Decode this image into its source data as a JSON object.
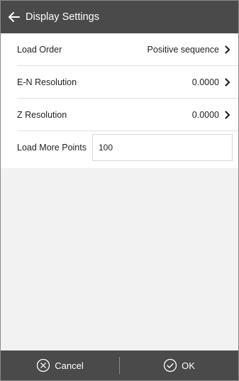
{
  "header": {
    "title": "Display Settings",
    "back_icon": "arrow-left-icon"
  },
  "rows": [
    {
      "label": "Load Order",
      "value": "Positive sequence",
      "icon": "chevron-right-icon"
    },
    {
      "label": "E-N Resolution",
      "value": "0.0000",
      "icon": "chevron-right-icon"
    },
    {
      "label": "Z Resolution",
      "value": "0.0000",
      "icon": "chevron-right-icon"
    }
  ],
  "load_more": {
    "label": "Load More Points",
    "value": "100"
  },
  "footer": {
    "cancel_label": "Cancel",
    "cancel_icon": "cancel-circle-icon",
    "ok_label": "OK",
    "ok_icon": "check-circle-icon"
  },
  "colors": {
    "header_bg": "#4a4a4a",
    "footer_bg": "#4a4a4a",
    "page_bg": "#f2f2f2",
    "divider": "#e0e0e0"
  }
}
